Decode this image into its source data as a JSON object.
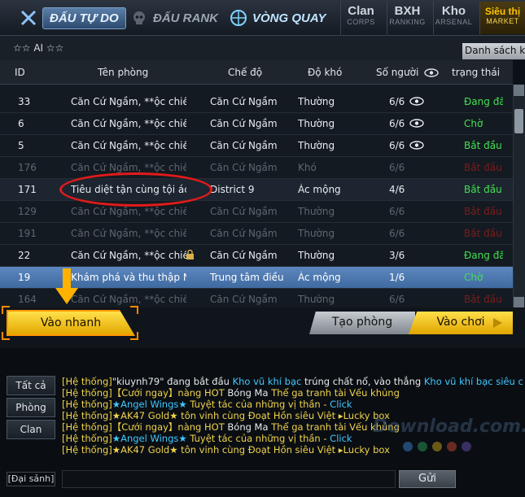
{
  "nav": {
    "tabs": [
      {
        "label": "ĐẤU TỰ DO"
      },
      {
        "label": "ĐẤU RANK"
      },
      {
        "label": "VÒNG QUAY"
      }
    ],
    "side_tabs": [
      {
        "label": "Clan",
        "sub": "CORPS"
      },
      {
        "label": "BXH",
        "sub": "RANKING"
      },
      {
        "label": "Kho",
        "sub": "ARSENAL"
      },
      {
        "label": "Siêu thị",
        "sub": "MARKET"
      }
    ]
  },
  "info": {
    "ai_label": "☆☆ AI ☆☆",
    "list_button": "Danh sách kênh"
  },
  "table": {
    "headers": [
      "ID",
      "Tên phòng",
      "Chế độ",
      "Độ khó",
      "Số người",
      "trạng thái"
    ],
    "rows": [
      {
        "id": "33",
        "name": "Căn Cứ Ngầm, **ộc chiến",
        "mode": "Căn Cứ Ngầm",
        "difficulty": "Thường",
        "players": "6/6",
        "status": "Đang đấu",
        "status_color": "green",
        "dim": false,
        "eye": true,
        "lock": false
      },
      {
        "id": "6",
        "name": "Căn Cứ Ngầm, **ộc chiến",
        "mode": "Căn Cứ Ngầm",
        "difficulty": "Thường",
        "players": "6/6",
        "status": "Chờ",
        "status_color": "green",
        "dim": false,
        "eye": true,
        "lock": false
      },
      {
        "id": "5",
        "name": "Căn Cứ Ngầm, **ộc chiến",
        "mode": "Căn Cứ Ngầm",
        "difficulty": "Thường",
        "players": "6/6",
        "status": "Bắt đầu",
        "status_color": "green",
        "dim": false,
        "eye": true,
        "lock": false
      },
      {
        "id": "176",
        "name": "Căn Cứ Ngầm, **ộc chiến",
        "mode": "Căn Cứ Ngầm",
        "difficulty": "Khó",
        "players": "6/6",
        "status": "Bắt đầu",
        "status_color": "red",
        "dim": true,
        "eye": false,
        "lock": false
      },
      {
        "id": "171",
        "name": "Tiêu diệt tận cùng tội ác",
        "mode": "District 9",
        "difficulty": "Ác mộng",
        "players": "4/6",
        "status": "Bắt đầu",
        "status_color": "green",
        "dim": false,
        "eye": false,
        "lock": false
      },
      {
        "id": "129",
        "name": "Căn Cứ Ngầm, **ộc chiến",
        "mode": "Căn Cứ Ngầm",
        "difficulty": "Thường",
        "players": "6/6",
        "status": "Bắt đầu",
        "status_color": "red",
        "dim": true,
        "eye": false,
        "lock": false
      },
      {
        "id": "191",
        "name": "Căn Cứ Ngầm, **ộc chiến",
        "mode": "Căn Cứ Ngầm",
        "difficulty": "Thường",
        "players": "6/6",
        "status": "Bắt đầu",
        "status_color": "red",
        "dim": true,
        "eye": false,
        "lock": false
      },
      {
        "id": "22",
        "name": "Căn Cứ Ngầm, **ộc chiến",
        "mode": "Căn Cứ Ngầm",
        "difficulty": "Thường",
        "players": "3/6",
        "status": "Đang đấu",
        "status_color": "green",
        "dim": false,
        "eye": false,
        "lock": true
      },
      {
        "id": "19",
        "name": "Khám phá và thu thập Nă",
        "mode": "Trung tâm điều l",
        "difficulty": "Ác mộng",
        "players": "1/6",
        "status": "Chờ",
        "status_color": "green",
        "dim": false,
        "eye": false,
        "lock": false,
        "selected": true
      },
      {
        "id": "164",
        "name": "Căn Cứ Ngầm, **ộc chiến",
        "mode": "Căn Cứ Ngầm",
        "difficulty": "Thường",
        "players": "6/6",
        "status": "Bắt đầu",
        "status_color": "red",
        "dim": true,
        "eye": false,
        "lock": false
      }
    ]
  },
  "actions": {
    "quick_join": "Vào nhanh",
    "create_room": "Tạo phòng",
    "play": "Vào chơi"
  },
  "chat": {
    "tabs": [
      "Tất cả",
      "Phòng",
      "Clan"
    ],
    "hall": "[Đại sảnh]",
    "send": "Gửi",
    "lines": [
      [
        [
          "cy",
          "[Hệ thống]"
        ],
        [
          "cw",
          "\"kiuynh79\" đang bắt đầu "
        ],
        [
          "cb",
          "Kho vũ khí bạc"
        ],
        [
          "cw",
          " trúng chất nổ, vào thẳng "
        ],
        [
          "cb",
          "Kho vũ khí bạc siêu cấp"
        ]
      ],
      [
        [
          "cy",
          "[Hệ thống]【Cưới ngay】nàng HOT "
        ],
        [
          "cw",
          "Bóng Ma "
        ],
        [
          "cy",
          "Thể ga tranh tài  Vếu khủng"
        ]
      ],
      [
        [
          "cy",
          "[Hệ thống]"
        ],
        [
          "cb",
          "★Angel Wings★"
        ],
        [
          "cy",
          "  Tuyệt tác của những vị thần - "
        ],
        [
          "cb",
          " Click"
        ]
      ],
      [
        [
          "cy",
          "[Hệ thống]★AK47 Gold★  tôn vinh  cùng Đoạt Hồn siêu Việt ▸Lucky box"
        ]
      ],
      [
        [
          "cy",
          "[Hệ thống]【Cưới ngay】nàng HOT "
        ],
        [
          "cw",
          "Bóng Ma "
        ],
        [
          "cy",
          "Thể ga tranh tài  Vếu khủng"
        ]
      ],
      [
        [
          "cy",
          "[Hệ thống]"
        ],
        [
          "cb",
          "★Angel Wings★"
        ],
        [
          "cy",
          "  Tuyệt tác của những vị thần - "
        ],
        [
          "cb",
          " Click"
        ]
      ],
      [
        [
          "cy",
          "[Hệ thống]★AK47 Gold★  tôn vinh  cùng Đoạt Hồn siêu Việt ▸Lucky box"
        ]
      ]
    ],
    "watermark": "Download.com.vn",
    "dot_colors": [
      "#3a7fd0",
      "#2a9a58",
      "#c9a31a",
      "#c7452f",
      "#6a4fb0"
    ]
  },
  "colors": {
    "accent": "#ffc400",
    "status_green": "#42e052",
    "status_red": "#e0322f",
    "highlight_circle": "#e21a1a"
  }
}
